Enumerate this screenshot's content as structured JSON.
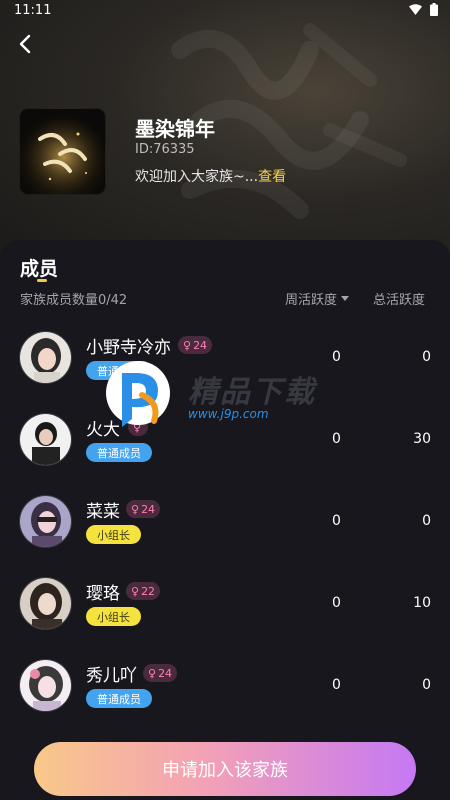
{
  "status_bar": {
    "time": "11:11"
  },
  "family": {
    "name": "墨染锦年",
    "id_text": "ID:76335",
    "description": "欢迎加入大家族~...",
    "view_link": "查看"
  },
  "members_section": {
    "title": "成员",
    "count_label": "家族成员数量0/42",
    "weekly_header": "周活跃度",
    "total_header": "总活跃度"
  },
  "members": [
    {
      "name": "小野寺冷亦",
      "level": "24",
      "role": "普通成员",
      "weekly": "0",
      "total": "0"
    },
    {
      "name": "火大",
      "level": "",
      "role": "普通成员",
      "weekly": "0",
      "total": "30"
    },
    {
      "name": "菜菜",
      "level": "24",
      "role": "小组长",
      "weekly": "0",
      "total": "0"
    },
    {
      "name": "璎珞",
      "level": "22",
      "role": "小组长",
      "weekly": "0",
      "total": "10"
    },
    {
      "name": "秀儿吖",
      "level": "24",
      "role": "普通成员",
      "weekly": "0",
      "total": "0"
    }
  ],
  "watermark": {
    "brand": "精品下载",
    "url": "www.j9p.com"
  },
  "apply_button": {
    "label": "申请加入该家族"
  },
  "colors": {
    "accent_yellow": "#f4d24a",
    "role_normal": "#43a3ef",
    "role_leader": "#f5e23e",
    "level_badge_text": "#ff7fb6",
    "button_gradient_start": "#f9c889",
    "button_gradient_end": "#c578f4"
  }
}
